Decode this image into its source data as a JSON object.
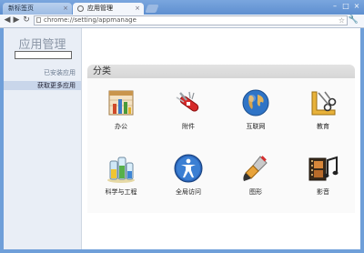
{
  "browser": {
    "tabs": [
      {
        "label": "新标签页",
        "active": false
      },
      {
        "label": "应用管理",
        "active": true
      }
    ],
    "tab_close_glyph": "×",
    "url": "chrome://setting/appmanage",
    "window_buttons": [
      "–",
      "□",
      "×"
    ],
    "nav_glyphs": {
      "back": "◀",
      "forward": "▶",
      "reload": "↻"
    },
    "star_glyph": "☆",
    "wrench_glyph": "🔧"
  },
  "sidebar": {
    "title": "应用管理",
    "search": {
      "value": ""
    },
    "items": [
      {
        "label": "已安装应用",
        "selected": false
      },
      {
        "label": "获取更多应用",
        "selected": true
      }
    ]
  },
  "main": {
    "section_title": "分类",
    "categories": [
      {
        "label": "办公",
        "icon": "office-chart-icon"
      },
      {
        "label": "附件",
        "icon": "swiss-army-knife-icon"
      },
      {
        "label": "互联网",
        "icon": "globe-icon"
      },
      {
        "label": "教育",
        "icon": "education-tools-icon"
      },
      {
        "label": "科学与工程",
        "icon": "science-beakers-icon"
      },
      {
        "label": "全局访问",
        "icon": "accessibility-icon"
      },
      {
        "label": "图形",
        "icon": "paint-brush-icon"
      },
      {
        "label": "影音",
        "icon": "film-music-icon"
      }
    ]
  },
  "colors": {
    "frame": "#6f9fd9",
    "sidebar_bg": "#e9eef6",
    "selected_item_bg": "#c9d6ea"
  }
}
